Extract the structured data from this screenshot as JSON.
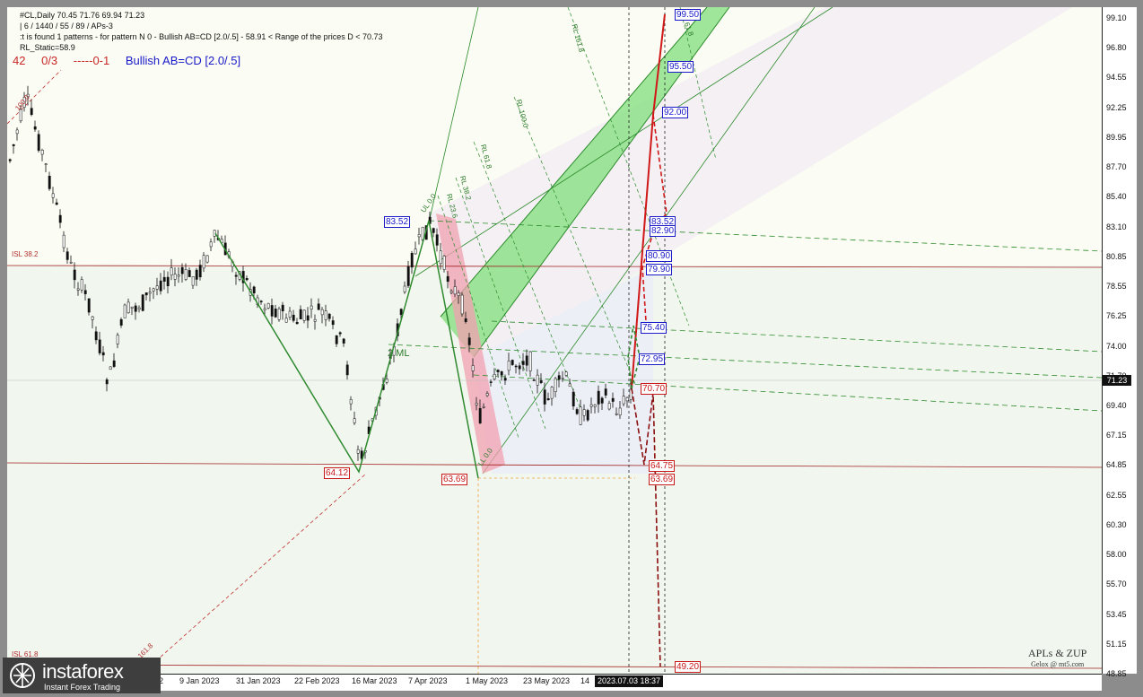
{
  "header": {
    "symbol_line": "#CL,Daily  70.45 71.76 69.94 71.23",
    "params_line": "| 6 / 1440 / 55 / 89 / APs-3",
    "pattern_line": ":t is found 1 patterns  -  for pattern N 0 - Bullish AB=CD [2.0/.5] - 58.91 < Range of the prices D < 70.73",
    "static_line": "RL_Static=58.9"
  },
  "legend": {
    "count": "42",
    "ratio": "0/3",
    "range": "-----0-1",
    "pattern": "Bullish AB=CD [2.0/.5]",
    "colors": {
      "count": "#c82828",
      "ratio": "#c82828",
      "range": "#c82828",
      "pattern": "#1a1ac8"
    }
  },
  "price_axis": [
    "99.10",
    "96.80",
    "94.55",
    "92.25",
    "89.95",
    "87.70",
    "85.40",
    "83.10",
    "80.85",
    "78.55",
    "76.25",
    "74.00",
    "71.70",
    "69.40",
    "67.15",
    "64.85",
    "62.55",
    "60.30",
    "58.00",
    "55.70",
    "53.45",
    "51.15",
    "48.85"
  ],
  "current_price": "71.23",
  "date_axis": [
    "22",
    "9 Jan 2023",
    "31 Jan 2023",
    "22 Feb 2023",
    "16 Mar 2023",
    "7 Apr 2023",
    "1 May 2023",
    "23 May 2023",
    "14"
  ],
  "current_time": "2023.07.03 18:37",
  "levels_blue": [
    "99.50",
    "95.50",
    "92.00",
    "83.52",
    "82.90",
    "80.90",
    "79.90",
    "75.40",
    "72.95",
    "83.52"
  ],
  "levels_red": [
    "70.70",
    "64.75",
    "63.69",
    "49.20",
    "64.12",
    "63.69"
  ],
  "annotations": {
    "isl_38": "ISL 38.2",
    "isl_61": "ISL 61.8",
    "fib_100": "100.0",
    "fib_161_left": "161.8",
    "ml": "2 ML",
    "rl_161": "RL 161.8",
    "rl_100": "RL 100.0",
    "rl_61": "RL 61.8",
    "rl_38": "RL 38.2",
    "rl_23": "RL 23.6",
    "ul_100": "UL 0.0",
    "ll_0": "LL 0.0",
    "r_61": "61.8"
  },
  "signature": {
    "line1": "APLs & ZUP",
    "line2": "Gelox @ mt5.com"
  },
  "logo": {
    "name": "instaforex",
    "tagline": "Instant Forex Trading"
  },
  "colors": {
    "chart_bg": "#f7f9ee",
    "green_channel": "#7ed87a",
    "pink_zone": "#f0a0b0",
    "pattern_green": "#2f8a2f",
    "pattern_red": "#d01818",
    "hline_red": "#a02020"
  }
}
